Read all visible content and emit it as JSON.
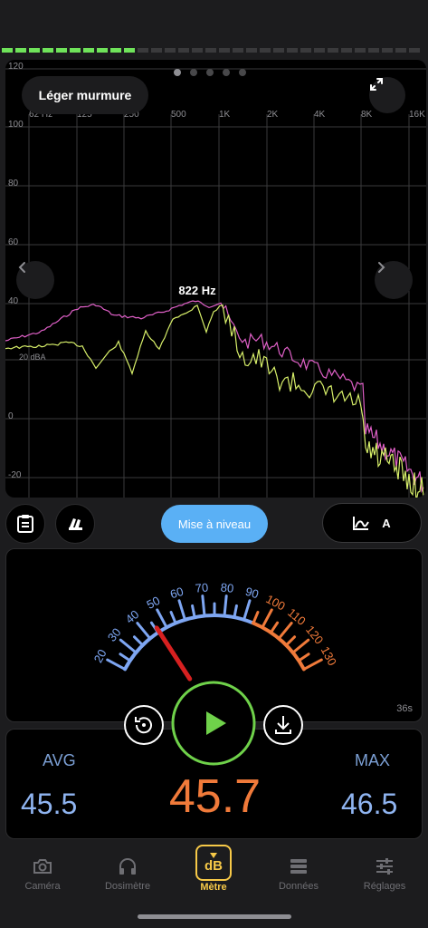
{
  "level_meter": {
    "lit_segments": 10,
    "total_segments": 31,
    "color_on": "#6fe35a",
    "color_off": "#3a3a3c"
  },
  "spectrum": {
    "noise_label": "Léger murmure",
    "peak_label": "822 Hz",
    "unit_label": "20 dBA",
    "freq_ticks": [
      "62 Hz",
      "125",
      "250",
      "500",
      "1K",
      "2K",
      "4K",
      "8K",
      "16K"
    ],
    "db_ticks": [
      "120",
      "100",
      "80",
      "60",
      "40",
      "0",
      "-20"
    ],
    "page_count": 5,
    "active_page": 0,
    "colors": {
      "max_series": "#e060c8",
      "current_series": "#d8f06a"
    }
  },
  "toolbar": {
    "upgrade_label": "Mise à niveau",
    "weighting_label": "A"
  },
  "gauge": {
    "ticks_low": [
      "20",
      "30",
      "40",
      "50",
      "60",
      "70",
      "80",
      "90"
    ],
    "ticks_high": [
      "100",
      "110",
      "120",
      "130"
    ],
    "needle_value": 45.7,
    "duration_label": "36s",
    "color_low": "#7ea6f2",
    "color_high": "#f07a3a",
    "needle_color": "#d62020"
  },
  "stats": {
    "avg_label": "AVG",
    "avg_value": "45.5",
    "current_value": "45.7",
    "max_label": "MAX",
    "max_value": "46.5"
  },
  "tabs": [
    {
      "label": "Caméra",
      "icon": "camera-icon"
    },
    {
      "label": "Dosimètre",
      "icon": "headphones-icon"
    },
    {
      "label": "Mètre",
      "icon": "db-meter-icon",
      "badge": "dB"
    },
    {
      "label": "Données",
      "icon": "database-icon"
    },
    {
      "label": "Réglages",
      "icon": "sliders-icon"
    }
  ]
}
